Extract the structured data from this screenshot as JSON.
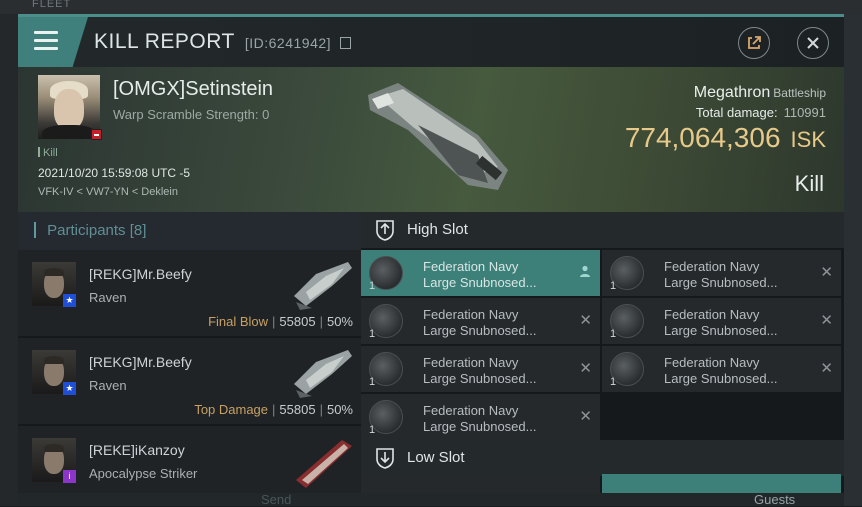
{
  "background": {
    "top_text": "FLEET",
    "send_label": "Send",
    "guests_label": "Guests"
  },
  "window": {
    "title": "KILL REPORT",
    "report_id": "[ID:6241942]",
    "icons": [
      "menu-icon",
      "copy-icon",
      "share-icon",
      "close-icon"
    ]
  },
  "victim": {
    "name": "[OMGX]Setinstein",
    "warp_scramble": "Warp Scramble Strength: 0",
    "kill_tag": "Kill",
    "datetime": "2021/10/20 15:59:08 UTC -5",
    "location": "VFK-IV < VW7-YN < Deklein",
    "ship_name": "Megathron",
    "ship_class": "Battleship",
    "total_damage_label": "Total damage:",
    "total_damage": "110991",
    "isk_value": "774,064,306",
    "isk_unit": "ISK",
    "result": "Kill"
  },
  "participants": {
    "label": "Participants",
    "count": "[8]",
    "rows": [
      {
        "name": "[REKG]Mr.Beefy",
        "ship": "Raven",
        "tag": "Final Blow",
        "damage": "55805",
        "percent": "50%",
        "badge": "★"
      },
      {
        "name": "[REKG]Mr.Beefy",
        "ship": "Raven",
        "tag": "Top Damage",
        "damage": "55805",
        "percent": "50%",
        "badge": "★"
      },
      {
        "name": "[REKE]iKanzoy",
        "ship": "Apocalypse Striker",
        "tag": "",
        "damage": "",
        "percent": "",
        "badge": "i"
      }
    ]
  },
  "fitting": {
    "high_slot_label": "High Slot",
    "low_slot_label": "Low Slot",
    "high_modules": [
      {
        "qty": "1",
        "line1": "Federation Navy",
        "line2": "Large Snubnosed...",
        "state": "person"
      },
      {
        "qty": "1",
        "line1": "Federation Navy",
        "line2": "Large Snubnosed...",
        "state": "x"
      },
      {
        "qty": "1",
        "line1": "Federation Navy",
        "line2": "Large Snubnosed...",
        "state": "x"
      },
      {
        "qty": "1",
        "line1": "Federation Navy",
        "line2": "Large Snubnosed...",
        "state": "x"
      },
      {
        "qty": "1",
        "line1": "Federation Navy",
        "line2": "Large Snubnosed...",
        "state": "x"
      },
      {
        "qty": "1",
        "line1": "Federation Navy",
        "line2": "Large Snubnosed...",
        "state": "x"
      },
      {
        "qty": "1",
        "line1": "Federation Navy",
        "line2": "Large Snubnosed...",
        "state": "x"
      }
    ]
  }
}
